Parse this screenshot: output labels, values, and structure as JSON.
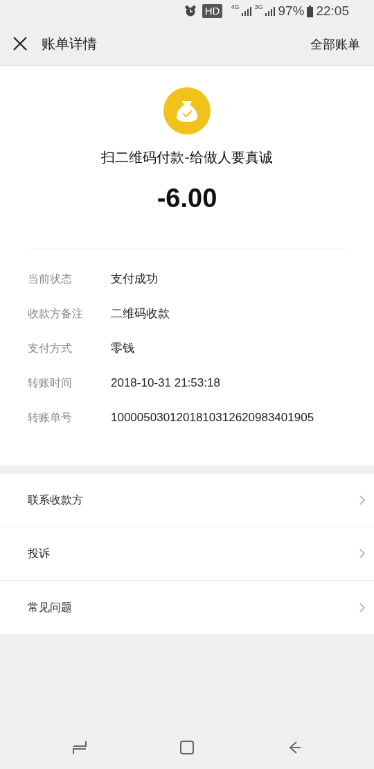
{
  "status_bar": {
    "badge": "HD",
    "network_1": "4G",
    "network_2": "3G",
    "battery": "97%",
    "time": "22:05"
  },
  "header": {
    "title": "账单详情",
    "action": "全部账单"
  },
  "payment": {
    "merchant": "扫二维码付款-给做人要真诚",
    "amount": "-6.00"
  },
  "details": [
    {
      "label": "当前状态",
      "value": "支付成功"
    },
    {
      "label": "收款方备注",
      "value": "二维码收款"
    },
    {
      "label": "支付方式",
      "value": "零钱"
    },
    {
      "label": "转账时间",
      "value": "2018-10-31 21:53:18"
    },
    {
      "label": "转账单号",
      "value": "1000050301201810312620983401905"
    }
  ],
  "actions": [
    {
      "label": "联系收款方"
    },
    {
      "label": "投诉"
    },
    {
      "label": "常见问题"
    }
  ]
}
